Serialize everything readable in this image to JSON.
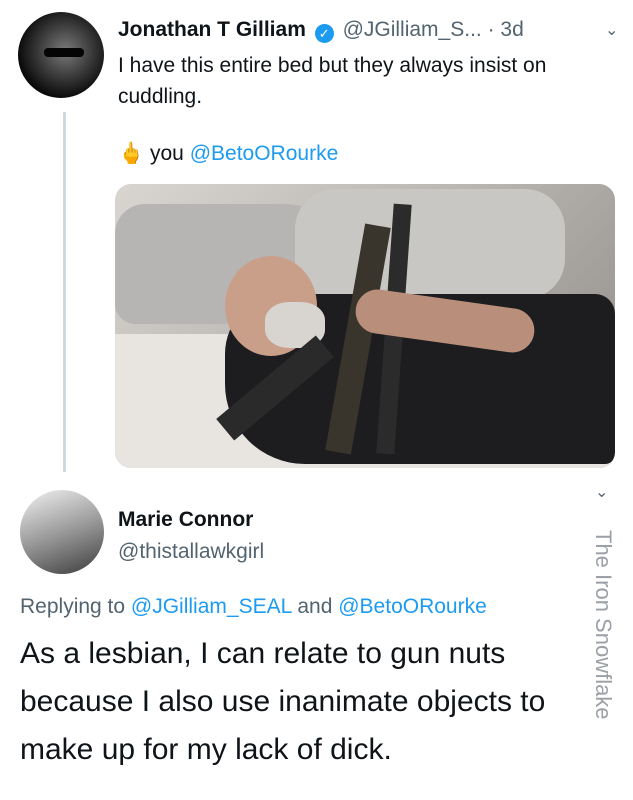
{
  "tweet1": {
    "author_name": "Jonathan T Gilliam",
    "verified_icon": "verified-badge-icon",
    "handle": "@JGilliam_S...",
    "time": "· 3d",
    "text": "I have this entire bed but they always insist on cuddling.",
    "caption_emoji": "🖕",
    "caption_word": "you",
    "caption_mention": "@BetoORourke",
    "menu_icon": "chevron-down-icon"
  },
  "tweet2": {
    "author_name": "Marie Connor",
    "handle": "@thistallawkgirl",
    "replying_prefix": "Replying to",
    "replying_mention1": "@JGilliam_SEAL",
    "replying_and": "and",
    "replying_mention2": "@BetoORourke",
    "text": "As a lesbian, I can relate to gun nuts because I also use inanimate objects to make up for my lack of dick."
  },
  "watermark": "The Iron Snowflake",
  "colors": {
    "link": "#1d9bf0",
    "muted": "#536471",
    "thread_line": "#cfd9de"
  }
}
